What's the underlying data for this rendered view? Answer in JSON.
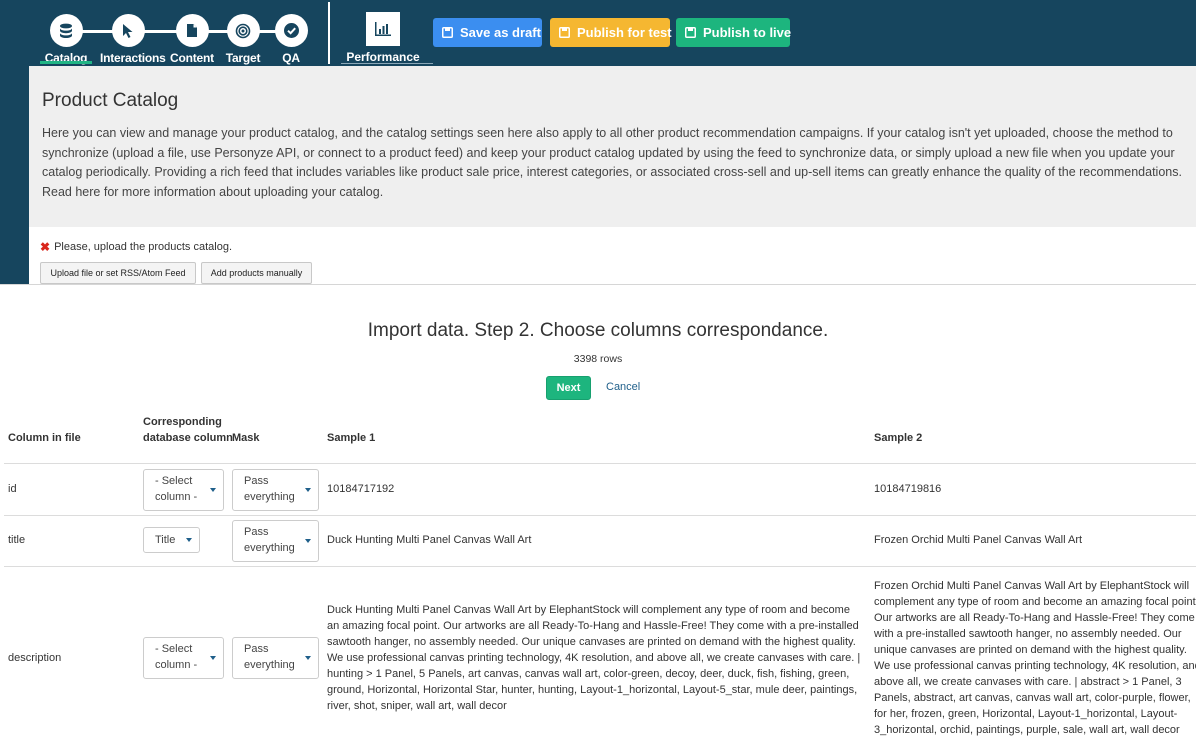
{
  "nav": {
    "steps": [
      {
        "label": "Catalog",
        "icon": "database-icon"
      },
      {
        "label": "Interactions",
        "icon": "cursor-icon"
      },
      {
        "label": "Content",
        "icon": "document-icon"
      },
      {
        "label": "Target",
        "icon": "target-icon"
      },
      {
        "label": "QA",
        "icon": "checkmark-icon"
      }
    ],
    "active_step": "Catalog",
    "performance_label": "Performance"
  },
  "toolbar": {
    "save_draft": "Save as draft",
    "publish_test": "Publish for test",
    "publish_live": "Publish to live"
  },
  "colors": {
    "nav_bg": "#16455e",
    "save_draft": "#3b8ef0",
    "publish_test": "#f5b731",
    "publish_live": "#1db57e",
    "active_underline": "#21b585",
    "error": "#d9261c"
  },
  "catalog": {
    "title": "Product Catalog",
    "description": "Here you can view and manage your product catalog, and the catalog settings seen here also apply to all other product recommendation campaigns. If your catalog isn't yet uploaded, choose the method to synchronize (upload a file, use Personyze API, or connect to a product feed) and keep your product catalog updated by using the feed to synchronize data, or simply upload a new file when you update your catalog periodically. Providing a rich feed that includes variables like product sale price, interest categories, or associated cross-sell and up-sell items can greatly enhance the quality of the recommendations. Read here for more information about uploading your catalog.",
    "warning": "Please, upload the products catalog.",
    "upload_button": "Upload file or set RSS/Atom Feed",
    "add_manual_button": "Add products manually"
  },
  "import": {
    "title": "Import data. Step 2. Choose columns correspondance.",
    "rows_count": "3398 rows",
    "next_label": "Next",
    "cancel_label": "Cancel",
    "headers": {
      "column": "Column in file",
      "db_column": "Corresponding database column",
      "mask": "Mask",
      "sample1": "Sample 1",
      "sample2": "Sample 2"
    },
    "rows": [
      {
        "column": "id",
        "db_column": "- Select column -",
        "mask": "Pass everything",
        "sample1": "10184717192",
        "sample2": "10184719816"
      },
      {
        "column": "title",
        "db_column": "Title",
        "mask": "Pass everything",
        "sample1": "Duck Hunting Multi Panel Canvas Wall Art",
        "sample2": "Frozen Orchid Multi Panel Canvas Wall Art"
      },
      {
        "column": "description",
        "db_column": "- Select column -",
        "mask": "Pass everything",
        "sample1": "Duck Hunting Multi Panel Canvas Wall Art by ElephantStock will complement any type of room and become an amazing focal point. Our artworks are all Ready-To-Hang and Hassle-Free! They come with a pre-installed sawtooth hanger, no assembly needed. Our unique canvases are printed on demand with the highest quality. We use professional canvas printing technology, 4K resolution, and above all, we create canvases with care. | hunting > 1 Panel, 5 Panels, art canvas, canvas wall art, color-green, decoy, deer, duck, fish, fishing, green, ground, Horizontal, Horizontal Star, hunter, hunting, Layout-1_horizontal, Layout-5_star, mule deer, paintings, river, shot, sniper, wall art, wall decor",
        "sample2": "Frozen Orchid Multi Panel Canvas Wall Art by ElephantStock will complement any type of room and become an amazing focal point. Our artworks are all Ready-To-Hang and Hassle-Free! They come with a pre-installed sawtooth hanger, no assembly needed. Our unique canvases are printed on demand with the highest quality. We use professional canvas printing technology, 4K resolution, and above all, we create canvases with care. | abstract > 1 Panel, 3 Panels, abstract, art canvas, canvas wall art, color-purple, flower, for her, frozen, green, Horizontal, Layout-1_horizontal, Layout-3_horizontal, orchid, paintings, purple, sale, wall art, wall decor"
      }
    ]
  }
}
